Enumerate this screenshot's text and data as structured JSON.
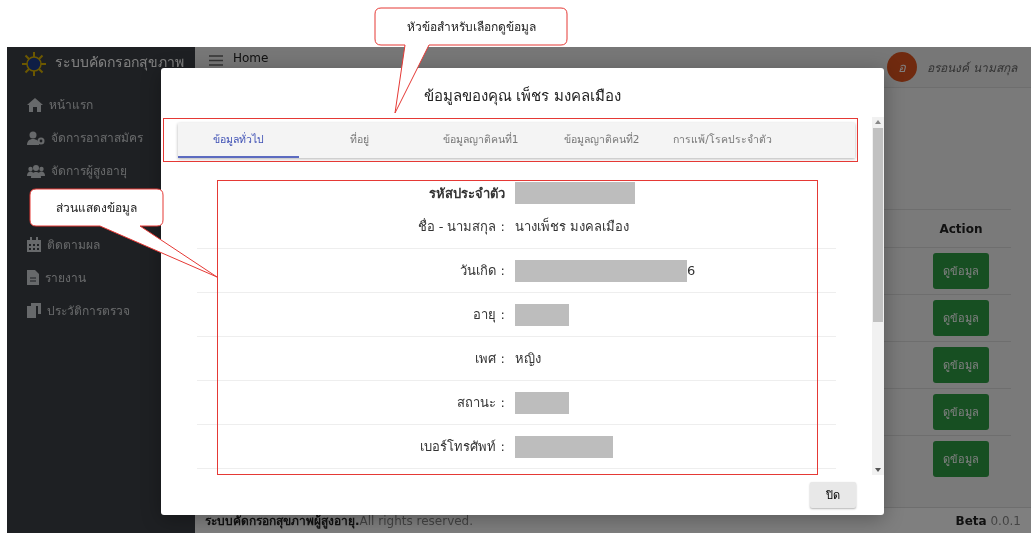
{
  "sidebar": {
    "brand": "ระบบคัดกรอกสุขภาพ",
    "items": [
      {
        "label": "หน้าแรก"
      },
      {
        "label": "จัดการอาสาสมัคร"
      },
      {
        "label": "จัดการผู้สูงอายุ"
      },
      {
        "label": "ติดตามผล"
      },
      {
        "label": "รายงาน"
      },
      {
        "label": "ประวัติการตรวจ"
      }
    ]
  },
  "topbar": {
    "title": "Home",
    "user": {
      "initial": "อ",
      "name": "อรอนงค์ นามสกุล"
    }
  },
  "table": {
    "columns": [
      "Action"
    ],
    "rows": [
      {
        "action": "ดูข้อมูล"
      },
      {
        "action": "ดูข้อมูล"
      },
      {
        "action": "ดูข้อมูล"
      },
      {
        "action": "ดูข้อมูล"
      },
      {
        "action": "ดูข้อมูล"
      }
    ]
  },
  "footer": {
    "text": "**ระบบคัดกรอกสุขภาพผู้สูงอายุ.**All rights reserved.",
    "version": "**Beta** 0.0.1"
  },
  "modal": {
    "title": "ข้อมูลของคุณ เพ็ชร มงคลเมือง",
    "tabs": [
      {
        "label": "ข้อมูลทั่วไป",
        "selected": true
      },
      {
        "label": "ที่อยู่",
        "selected": false
      },
      {
        "label": "ข้อมูลญาติคนที่1",
        "selected": false
      },
      {
        "label": "ข้อมูลญาติคนที่2",
        "selected": false
      },
      {
        "label": "การแพ้/โรคประจำตัว",
        "selected": false
      }
    ],
    "fields": [
      {
        "label": "รหัสประจำตัว",
        "bold": true,
        "redacted": true
      },
      {
        "label": "ชื่อ - นามสกุล :",
        "bold": false,
        "redacted": false,
        "value": "นางเพ็ชร มงคลเมือง"
      },
      {
        "label": "วันเกิด :",
        "bold": false,
        "redacted": true,
        "value": "6"
      },
      {
        "label": "อายุ :",
        "bold": false,
        "redacted": true
      },
      {
        "label": "เพศ :",
        "bold": false,
        "redacted": false,
        "value": "หญิง"
      },
      {
        "label": "สถานะ :",
        "bold": false,
        "redacted": true
      },
      {
        "label": "เบอร์โทรศัพท์ :",
        "bold": false,
        "redacted": true
      }
    ],
    "buttons": [
      "ปิด"
    ]
  },
  "annotations": [
    {
      "text": "หัวข้อสำหรับเลือกดูข้อมูล"
    },
    {
      "text": "ส่วนแสดงข้อมูล"
    }
  ]
}
